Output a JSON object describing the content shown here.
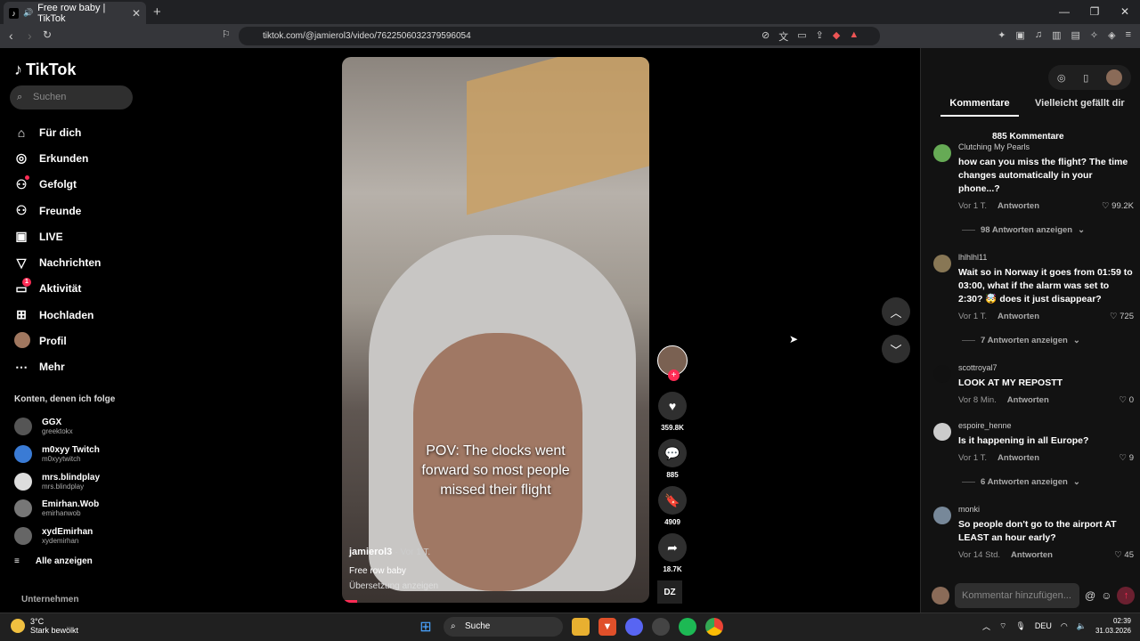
{
  "browser": {
    "tab_title": "Free row baby | TikTok",
    "url": "tiktok.com/@jamierol3/video/7622506032379596054",
    "new_tab": "+",
    "close": "✕"
  },
  "sidebar": {
    "logo": "TikTok",
    "search_placeholder": "Suchen",
    "menu": [
      {
        "label": "Für dich",
        "icon": "home-icon",
        "glyph": "⌂"
      },
      {
        "label": "Erkunden",
        "icon": "compass-icon",
        "glyph": "◎"
      },
      {
        "label": "Gefolgt",
        "icon": "following-icon",
        "glyph": "⚇"
      },
      {
        "label": "Freunde",
        "icon": "friends-icon",
        "glyph": "⚇"
      },
      {
        "label": "LIVE",
        "icon": "live-icon",
        "glyph": "▣"
      },
      {
        "label": "Nachrichten",
        "icon": "messages-icon",
        "glyph": "▽"
      },
      {
        "label": "Aktivität",
        "icon": "activity-icon",
        "glyph": "▭",
        "badge": "1"
      },
      {
        "label": "Hochladen",
        "icon": "upload-icon",
        "glyph": "⊞"
      },
      {
        "label": "Profil",
        "icon": "profile-avatar",
        "glyph": ""
      },
      {
        "label": "Mehr",
        "icon": "more-icon",
        "glyph": "⋯"
      }
    ],
    "following_header": "Konten, denen ich folge",
    "following": [
      {
        "name": "GGX",
        "user": "greektokx",
        "color": "#555"
      },
      {
        "name": "m0xyy Twitch",
        "user": "m0xyytwitch",
        "color": "#3a7bd5"
      },
      {
        "name": "mrs.blindplay",
        "user": "mrs.blindplay",
        "color": "#ddd"
      },
      {
        "name": "Emirhan.Wob",
        "user": "emirhanwob",
        "color": "#777"
      },
      {
        "name": "xydEmirhan",
        "user": "xydemirhan",
        "color": "#666"
      }
    ],
    "show_all": "Alle anzeigen",
    "company": "Unternehmen"
  },
  "video": {
    "caption_lines": [
      "POV: The clocks went",
      "forward so most people",
      "missed their flight"
    ],
    "username": "jamierol3",
    "time": "· Vor 1 T.",
    "description": "Free row baby",
    "translate": "Übersetzung anzeigen",
    "progress": 0.05
  },
  "actions": {
    "likes": "359.8K",
    "comments": "885",
    "saves": "4909",
    "shares": "18.7K",
    "music_logo": "DZ"
  },
  "panel": {
    "tab_comments": "Kommentare",
    "tab_maybe": "Vielleicht gefällt dir",
    "total": "885 Kommentare",
    "comments": [
      {
        "name": "Clutching My Pearls",
        "text": "how can you miss the flight? The time changes automatically in your phone...?",
        "time": "Vor 1 T.",
        "reply": "Antworten",
        "likes": "99.2K",
        "more": "98 Antworten anzeigen",
        "color": "#6a5"
      },
      {
        "name": "lhlhlhl11",
        "text": "Wait so in Norway it goes from 01:59 to 03:00, what if the alarm was set to 2:30? 🤯 does it just disappear?",
        "time": "Vor 1 T.",
        "reply": "Antworten",
        "likes": "725",
        "more": "7 Antworten anzeigen",
        "color": "#875"
      },
      {
        "name": "scottroyal7",
        "text": "LOOK AT MY REPOSTT",
        "time": "Vor 8 Min.",
        "reply": "Antworten",
        "likes": "0",
        "more": "",
        "color": "#111"
      },
      {
        "name": "espoire_henne",
        "text": "Is it happening in all Europe?",
        "time": "Vor 1 T.",
        "reply": "Antworten",
        "likes": "9",
        "more": "6 Antworten anzeigen",
        "color": "#ccc"
      },
      {
        "name": "monki",
        "text": "So people don't go to the airport AT LEAST an hour early?",
        "time": "Vor 14 Std.",
        "reply": "Antworten",
        "likes": "45",
        "more": "",
        "color": "#789"
      }
    ],
    "input_placeholder": "Kommentar hinzufügen..."
  },
  "taskbar": {
    "temp": "3°C",
    "weather": "Stark bewölkt",
    "search": "Suche",
    "lang": "DEU",
    "time": "02:39",
    "date": "31.03.2026"
  }
}
